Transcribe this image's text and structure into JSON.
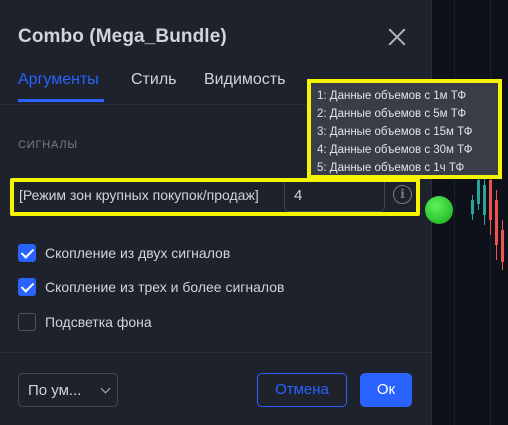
{
  "dialog": {
    "title": "Combo (Mega_Bundle)",
    "tabs": [
      {
        "label": "Аргументы",
        "active": true
      },
      {
        "label": "Стиль",
        "active": false
      },
      {
        "label": "Видимость",
        "active": false
      }
    ],
    "section_title": "СИГНАЛЫ",
    "mode_field": {
      "label": "[Режим зон крупных покупок/продаж]",
      "value": "4"
    },
    "checkboxes": [
      {
        "label": "Скопление из двух сигналов",
        "checked": true
      },
      {
        "label": "Скопление из трех и более сигналов",
        "checked": true
      },
      {
        "label": "Подсветка фона",
        "checked": false
      }
    ],
    "footer": {
      "defaults_label": "По ум...",
      "cancel_label": "Отмена",
      "ok_label": "Ок"
    }
  },
  "tooltip": {
    "lines": [
      "1: Данные объемов с 1м ТФ",
      "2: Данные объемов с 5м ТФ",
      "3: Данные объемов с 15м ТФ",
      "4: Данные объемов с 30м ТФ",
      "5: Данные объемов с 1ч ТФ"
    ]
  },
  "colors": {
    "accent": "#2962ff",
    "highlight": "#f5f500",
    "signal_green": "#22c322",
    "candle_up": "#26a69a",
    "candle_down": "#ef5350"
  },
  "icons": {
    "close": "close-icon",
    "info": "info-icon",
    "check": "check-icon",
    "dropdown": "chevron-down-icon"
  }
}
